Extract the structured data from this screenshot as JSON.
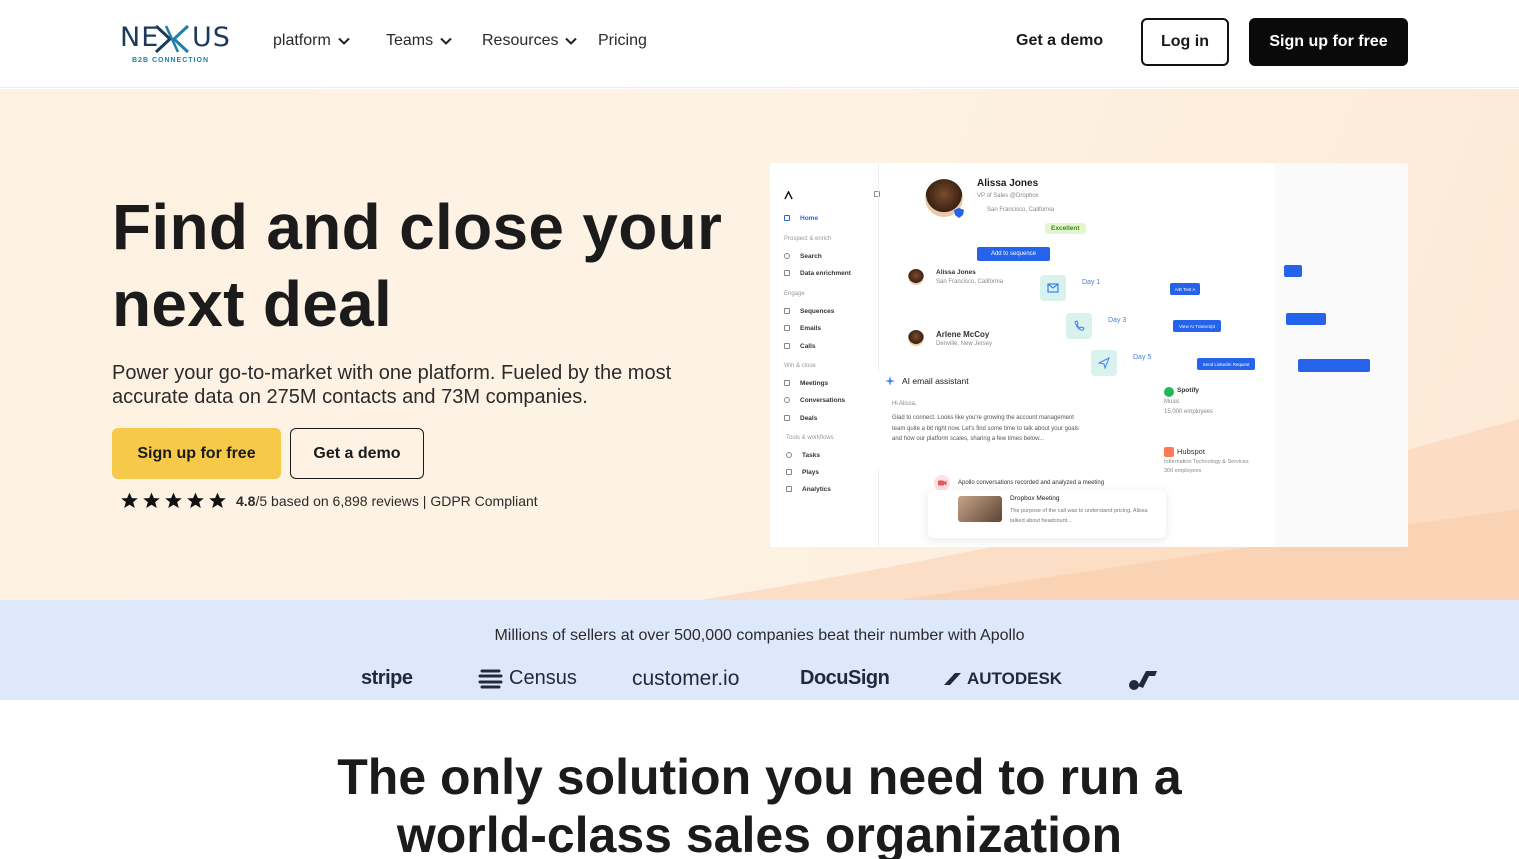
{
  "brand": {
    "name": "NEXUS",
    "tagline": "B2B CONNECTION",
    "colors": {
      "primary": "#1d3a5c",
      "accent": "#1f7fa8"
    }
  },
  "nav": {
    "links": [
      {
        "label": "platform",
        "has_dropdown": true
      },
      {
        "label": "Teams",
        "has_dropdown": true
      },
      {
        "label": "Resources",
        "has_dropdown": true
      },
      {
        "label": "Pricing",
        "has_dropdown": false
      }
    ],
    "get_demo": "Get a demo",
    "login": "Log in",
    "signup": "Sign up for free"
  },
  "hero": {
    "title": "Find and close your next deal",
    "subtitle": "Power your go-to-market with one platform. Fueled by the most accurate data on 275M contacts and 73M companies.",
    "cta_primary": "Sign up for free",
    "cta_secondary": "Get a demo",
    "rating": {
      "stars": 5,
      "score": "4.8",
      "suffix": "/5 based on 6,898 reviews | GDPR Compliant"
    },
    "colors": {
      "cta_primary_bg": "#f7c948",
      "background": "#fdf1e1"
    }
  },
  "app_mock": {
    "sidebar": {
      "home": "Home",
      "groups": [
        {
          "title": "Prospect & enrich",
          "items": [
            "Search",
            "Data enrichment"
          ]
        },
        {
          "title": "Engage",
          "items": [
            "Sequences",
            "Emails",
            "Calls"
          ]
        },
        {
          "title": "Win & close",
          "items": [
            "Meetings",
            "Conversations",
            "Deals"
          ]
        },
        {
          "title": "Tools & workflows",
          "items": [
            "Tasks",
            "Plays",
            "Analytics"
          ]
        }
      ]
    },
    "contact": {
      "name": "Alissa Jones",
      "title": "VP of Sales @Dropbox",
      "location": "San Francisco, California",
      "badge": "Excellent",
      "action": "Add to sequence"
    },
    "list": [
      {
        "name": "Alissa Jones",
        "location": "San Francisco, California"
      },
      {
        "name": "Arlene McCoy",
        "location": "Denville, New Jersey"
      }
    ],
    "days": [
      "Day 1",
      "Day 3",
      "Day 5"
    ],
    "day_actions": [
      "A/B Test A",
      "View AI Transcript",
      "Send LinkedIn Request"
    ],
    "ai_email": {
      "title": "AI email assistant",
      "greeting": "Hi Alissa,",
      "body": "Glad to connect. Looks like you're growing the account management team quite a bit right now. Let's find some time to talk about your goals and how our platform scales, sharing a few times below..."
    },
    "companies": [
      {
        "name": "Spotify",
        "industry": "Music",
        "size": "15,000 employees"
      },
      {
        "name": "Hubspot",
        "industry": "Information Technology & Services",
        "size": "300 employees"
      }
    ],
    "conversation": {
      "note": "Apollo conversations recorded and analyzed a meeting",
      "meeting": "Dropbox Meeting",
      "detail": "The purpose of the call was to understand pricing. Alissa talked about headcount..."
    }
  },
  "social_proof": {
    "headline": "Millions of sellers at over 500,000 companies beat their number with Apollo",
    "logos": [
      "stripe",
      "Census",
      "customer.io",
      "DocuSign",
      "AUTODESK",
      "jazz-logo"
    ],
    "background": "#dde8fb"
  },
  "section": {
    "title_line1": "The only solution you need to run a",
    "title_line2": "world-class sales organization"
  }
}
